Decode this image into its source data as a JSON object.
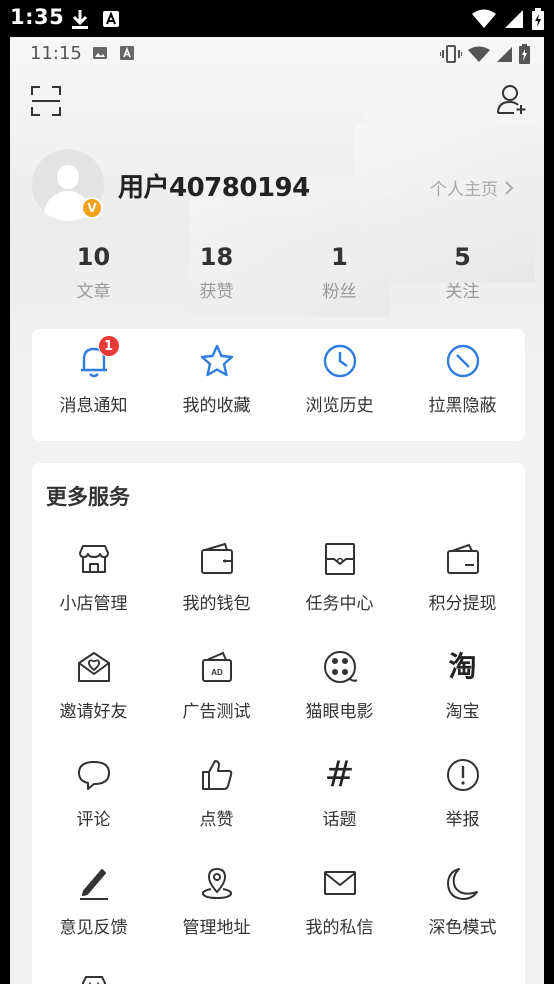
{
  "system_status": {
    "time": "1:35"
  },
  "inner_status": {
    "time": "11:15"
  },
  "profile": {
    "username": "用户40780194",
    "badge": "V",
    "profile_link": "个人主页"
  },
  "stats": [
    {
      "value": "10",
      "label": "文章"
    },
    {
      "value": "18",
      "label": "获赞"
    },
    {
      "value": "1",
      "label": "粉丝"
    },
    {
      "value": "5",
      "label": "关注"
    }
  ],
  "quick_actions": [
    {
      "label": "消息通知",
      "icon": "bell-icon",
      "badge": "1"
    },
    {
      "label": "我的收藏",
      "icon": "star-icon"
    },
    {
      "label": "浏览历史",
      "icon": "clock-icon"
    },
    {
      "label": "拉黑隐蔽",
      "icon": "block-icon"
    }
  ],
  "more_services": {
    "title": "更多服务",
    "items": [
      {
        "label": "小店管理",
        "icon": "shop-icon"
      },
      {
        "label": "我的钱包",
        "icon": "wallet-icon"
      },
      {
        "label": "任务中心",
        "icon": "task-icon"
      },
      {
        "label": "积分提现",
        "icon": "points-wallet-icon"
      },
      {
        "label": "邀请好友",
        "icon": "invite-icon"
      },
      {
        "label": "广告测试",
        "icon": "ad-icon"
      },
      {
        "label": "猫眼电影",
        "icon": "film-reel-icon"
      },
      {
        "label": "淘宝",
        "icon": "taobao-icon",
        "glyph": "淘"
      },
      {
        "label": "评论",
        "icon": "comment-icon"
      },
      {
        "label": "点赞",
        "icon": "thumbs-up-icon"
      },
      {
        "label": "话题",
        "icon": "hashtag-icon",
        "glyph": "#"
      },
      {
        "label": "举报",
        "icon": "report-icon"
      },
      {
        "label": "意见反馈",
        "icon": "pen-icon"
      },
      {
        "label": "管理地址",
        "icon": "location-icon"
      },
      {
        "label": "我的私信",
        "icon": "mail-icon"
      },
      {
        "label": "深色模式",
        "icon": "moon-icon"
      }
    ]
  },
  "colors": {
    "accent_blue": "#2f7de1",
    "badge_red": "#e93a3a",
    "vip_orange": "#f0a21a"
  }
}
